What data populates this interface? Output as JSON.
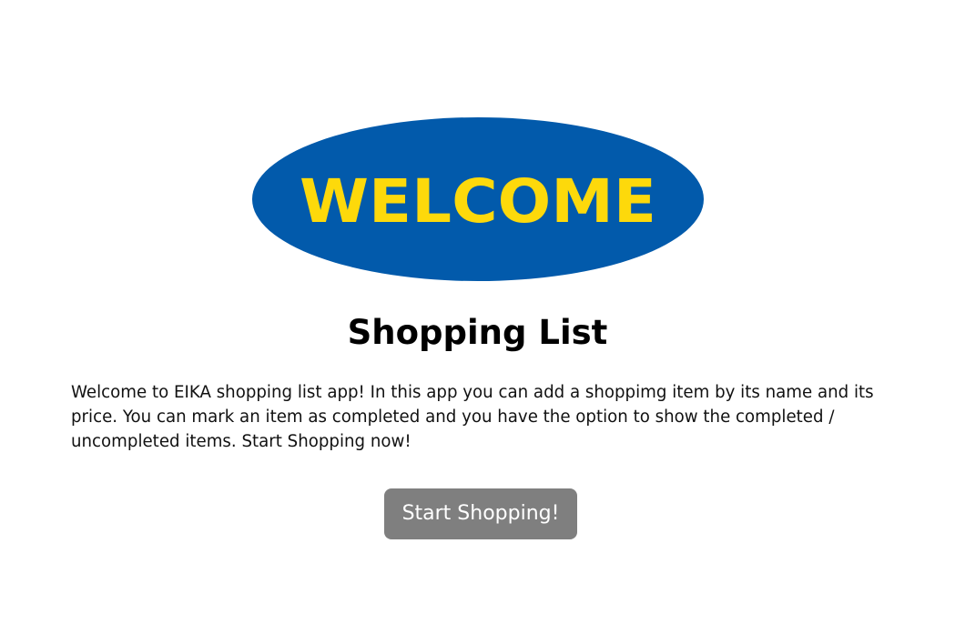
{
  "logo": {
    "text": "WELCOME",
    "background_color": "#025aab",
    "text_color": "#fdd90b"
  },
  "title": "Shopping List",
  "description": "Welcome to EIKA shopping list app! In this app you can add a shoppimg item by its name and its price. You can mark an item as completed and you have the option to show the completed / uncompleted items. Start Shopping now!",
  "start_button": {
    "label": "Start Shopping!",
    "background_color": "#7f7f7f"
  }
}
